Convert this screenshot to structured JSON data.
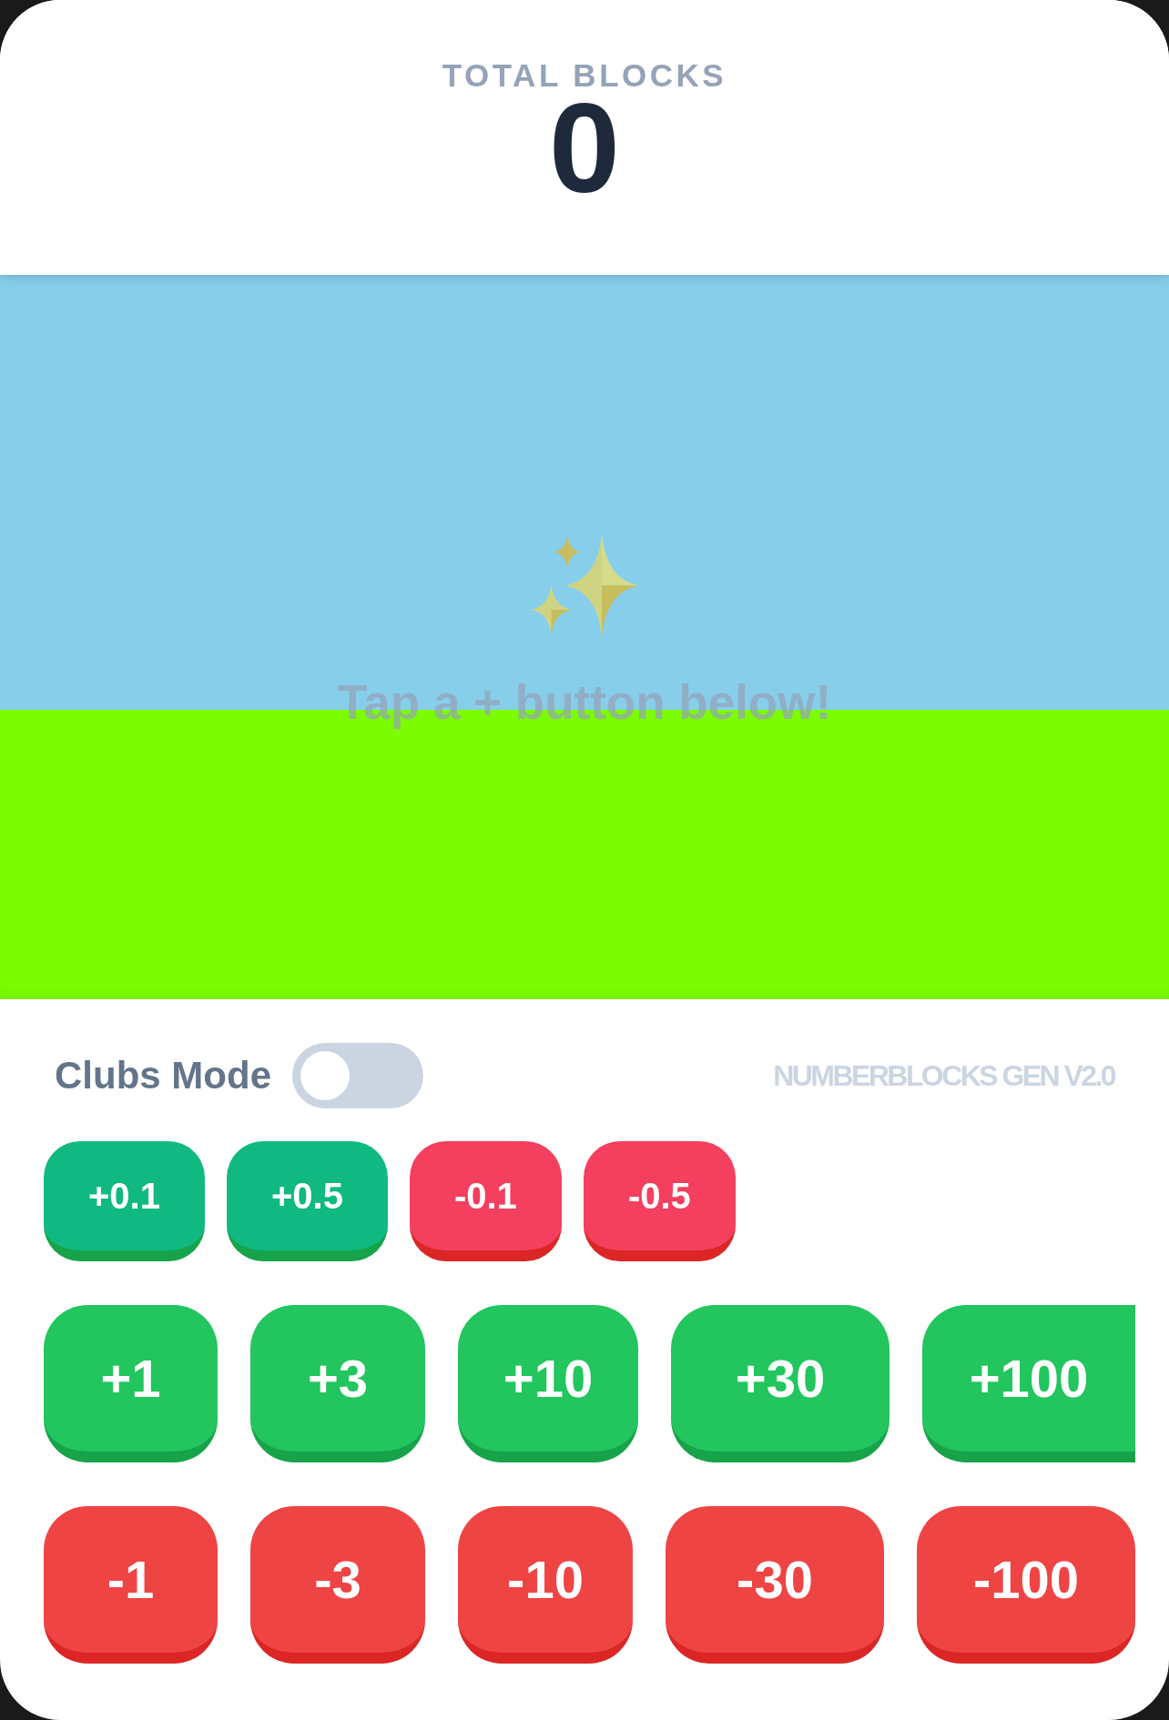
{
  "score": {
    "label": "TOTAL BLOCKS",
    "value": "0"
  },
  "scene": {
    "hint": "Tap a + button below!"
  },
  "controls": {
    "toggle": {
      "label": "Clubs Mode",
      "on": false
    },
    "version": "NUMBERBLOCKS GEN V2.0"
  },
  "fine_buttons": [
    {
      "label": "+0.1",
      "kind": "add"
    },
    {
      "label": "+0.5",
      "kind": "add"
    },
    {
      "label": "-0.1",
      "kind": "subtract"
    },
    {
      "label": "-0.5",
      "kind": "subtract"
    }
  ],
  "step_rows": [
    {
      "buttons": [
        {
          "label": "+1",
          "kind": "add"
        },
        {
          "label": "+3",
          "kind": "add"
        },
        {
          "label": "+10",
          "kind": "add"
        },
        {
          "label": "+30",
          "kind": "add"
        },
        {
          "label": "+100",
          "kind": "add"
        }
      ]
    },
    {
      "buttons": [
        {
          "label": "-1",
          "kind": "subtract"
        },
        {
          "label": "-3",
          "kind": "subtract"
        },
        {
          "label": "-10",
          "kind": "subtract"
        },
        {
          "label": "-30",
          "kind": "subtract"
        },
        {
          "label": "-100",
          "kind": "subtract"
        }
      ]
    }
  ]
}
